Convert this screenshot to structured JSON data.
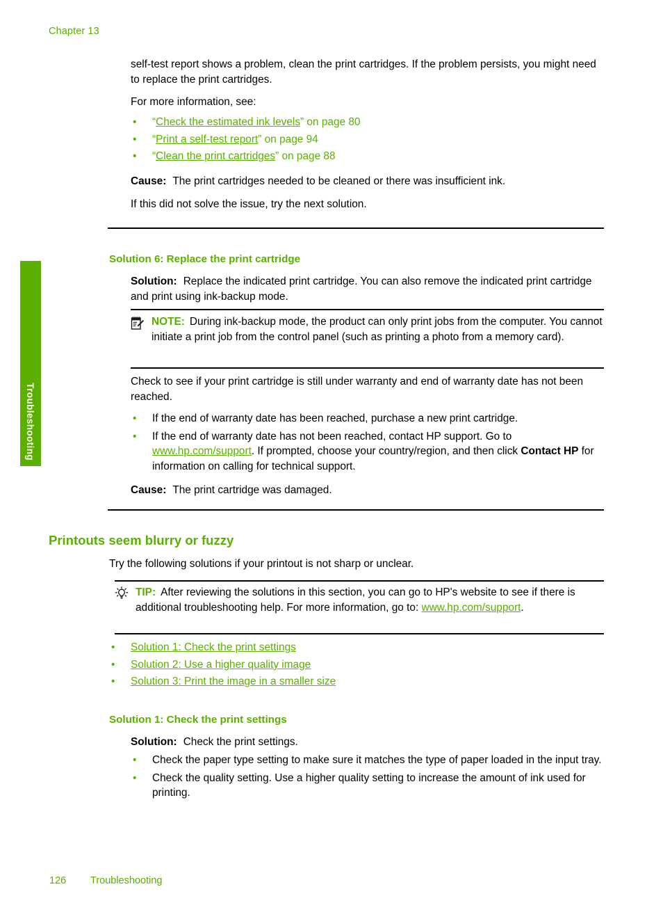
{
  "page": {
    "chapter_label": "Chapter 13",
    "side_tab_label": "Troubleshooting",
    "footer_page_number": "126",
    "footer_section": "Troubleshooting",
    "accent_color": "#5AAF00",
    "text_color": "#000000"
  },
  "intro": {
    "paragraph_1": "self-test report shows a problem, clean the print cartridges. If the problem persists, you might need to replace the print cartridges.",
    "paragraph_2": "For more information, see:",
    "see_also": [
      {
        "quote_open": "“",
        "title": "Check the estimated ink levels",
        "quote_close": "”",
        "page_ref": " on page 80"
      },
      {
        "quote_open": "“",
        "title": "Print a self-test report",
        "quote_close": "”",
        "page_ref": " on page 94"
      },
      {
        "quote_open": "“",
        "title": "Clean the print cartridges",
        "quote_close": "”",
        "page_ref": " on page 88"
      }
    ],
    "cause_label": "Cause:",
    "cause_text": "The print cartridges needed to be cleaned or there was insufficient ink.",
    "next_solution_text": "If this did not solve the issue, try the next solution."
  },
  "solution_6": {
    "heading": "Solution 6: Replace the print cartridge",
    "solution_label": "Solution:",
    "solution_text": "Replace the indicated print cartridge. You can also remove the indicated print cartridge and print using ink-backup mode.",
    "note": {
      "icon": "note-pad-pencil-icon",
      "keyword": "NOTE:",
      "text": "During ink-backup mode, the product can only print jobs from the computer. You cannot initiate a print job from the control panel (such as printing a photo from a memory card)."
    },
    "warranty_text": "Check to see if your print cartridge is still under warranty and end of warranty date has not been reached.",
    "warranty_bullets": [
      {
        "text": "If the end of warranty date has been reached, purchase a new print cartridge."
      }
    ],
    "warranty_bullet_2": {
      "part_1": "If the end of warranty date has not been reached, contact HP support. Go to ",
      "link": "www.hp.com/support",
      "part_2": ". If prompted, choose your country/region, and then click ",
      "bold": "Contact HP",
      "part_3": " for information on calling for technical support."
    },
    "cause_label": "Cause:",
    "cause_text": "The print cartridge was damaged."
  },
  "blurry_section": {
    "heading": "Printouts seem blurry or fuzzy",
    "intro": "Try the following solutions if your printout is not sharp or unclear.",
    "tip": {
      "icon": "lightbulb-icon",
      "keyword": "TIP:",
      "part_1": "After reviewing the solutions in this section, you can go to HP's website to see if there is additional troubleshooting help. For more information, go to: ",
      "link": "www.hp.com/support",
      "part_2": "."
    },
    "solution_links": [
      {
        "label": "Solution 1: Check the print settings"
      },
      {
        "label": "Solution 2: Use a higher quality image"
      },
      {
        "label": "Solution 3: Print the image in a smaller size"
      }
    ]
  },
  "solution_1": {
    "heading": "Solution 1: Check the print settings",
    "solution_label": "Solution:",
    "solution_text": "Check the print settings.",
    "bullets": [
      {
        "text": "Check the paper type setting to make sure it matches the type of paper loaded in the input tray."
      },
      {
        "text": "Check the quality setting. Use a higher quality setting to increase the amount of ink used for printing."
      }
    ]
  }
}
